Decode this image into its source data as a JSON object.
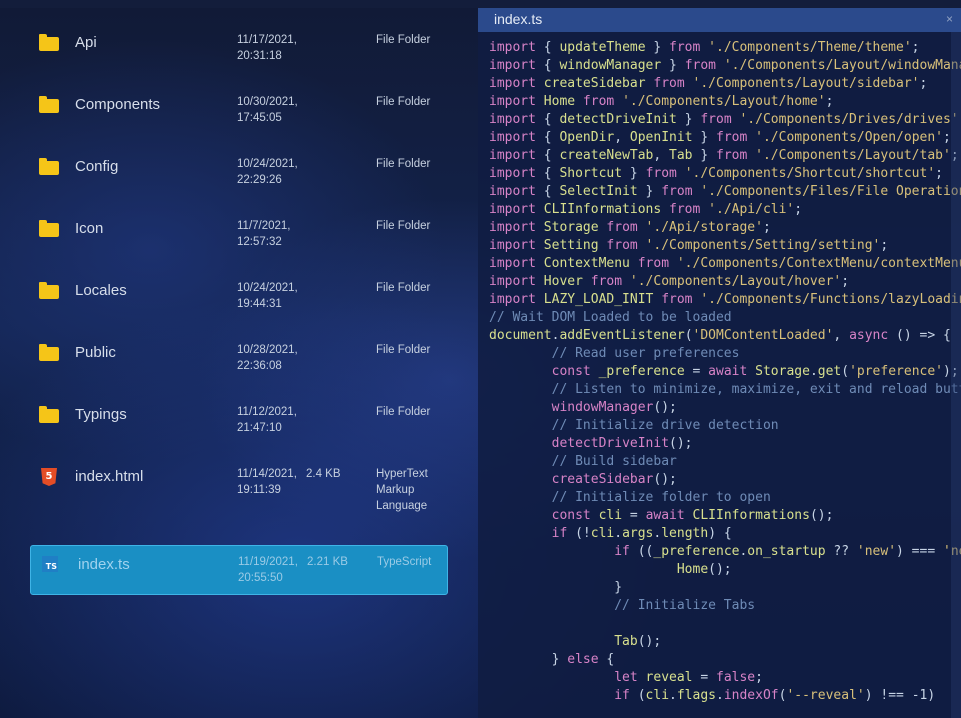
{
  "files": [
    {
      "name": "Api",
      "date_line1": "11/17/2021,",
      "date_line2": "20:31:18",
      "size": "",
      "type": "File Folder",
      "icon": "folder-icon"
    },
    {
      "name": "Components",
      "date_line1": "10/30/2021,",
      "date_line2": "17:45:05",
      "size": "",
      "type": "File Folder",
      "icon": "folder-icon"
    },
    {
      "name": "Config",
      "date_line1": "10/24/2021,",
      "date_line2": "22:29:26",
      "size": "",
      "type": "File Folder",
      "icon": "folder-icon"
    },
    {
      "name": "Icon",
      "date_line1": "11/7/2021,",
      "date_line2": "12:57:32",
      "size": "",
      "type": "File Folder",
      "icon": "folder-icon"
    },
    {
      "name": "Locales",
      "date_line1": "10/24/2021,",
      "date_line2": "19:44:31",
      "size": "",
      "type": "File Folder",
      "icon": "folder-icon"
    },
    {
      "name": "Public",
      "date_line1": "10/28/2021,",
      "date_line2": "22:36:08",
      "size": "",
      "type": "File Folder",
      "icon": "folder-icon"
    },
    {
      "name": "Typings",
      "date_line1": "11/12/2021,",
      "date_line2": "21:47:10",
      "size": "",
      "type": "File Folder",
      "icon": "folder-icon"
    },
    {
      "name": "index.html",
      "date_line1": "11/14/2021,",
      "date_line2": "19:11:39",
      "size": "2.4 KB",
      "type": "HyperText Markup Language",
      "icon": "html5-icon"
    },
    {
      "name": "index.ts",
      "date_line1": "11/19/2021,",
      "date_line2": "20:55:50",
      "size": "2.21 KB",
      "type": "TypeScript",
      "icon": "typescript-icon",
      "selected": true
    }
  ],
  "preview": {
    "title": "index.ts",
    "close": "×",
    "lines": [
      [
        [
          "kw",
          "import"
        ],
        [
          "pl",
          " { "
        ],
        [
          "id",
          "updateTheme"
        ],
        [
          "pl",
          " } "
        ],
        [
          "kw",
          "from"
        ],
        [
          "str",
          " './Components/Theme/theme'"
        ],
        [
          "pl",
          ";"
        ]
      ],
      [
        [
          "kw",
          "import"
        ],
        [
          "pl",
          " { "
        ],
        [
          "id",
          "windowManager"
        ],
        [
          "pl",
          " } "
        ],
        [
          "kw",
          "from"
        ],
        [
          "str",
          " './Components/Layout/windowManager'"
        ],
        [
          "pl",
          ";"
        ]
      ],
      [
        [
          "kw",
          "import"
        ],
        [
          "id",
          " createSidebar"
        ],
        [
          "kw",
          " from"
        ],
        [
          "str",
          " './Components/Layout/sidebar'"
        ],
        [
          "pl",
          ";"
        ]
      ],
      [
        [
          "kw",
          "import"
        ],
        [
          "id",
          " Home"
        ],
        [
          "kw",
          " from"
        ],
        [
          "str",
          " './Components/Layout/home'"
        ],
        [
          "pl",
          ";"
        ]
      ],
      [
        [
          "kw",
          "import"
        ],
        [
          "pl",
          " { "
        ],
        [
          "id",
          "detectDriveInit"
        ],
        [
          "pl",
          " } "
        ],
        [
          "kw",
          "from"
        ],
        [
          "str",
          " './Components/Drives/drives'"
        ],
        [
          "pl",
          ";"
        ]
      ],
      [
        [
          "kw",
          "import"
        ],
        [
          "pl",
          " { "
        ],
        [
          "id",
          "OpenDir"
        ],
        [
          "pl",
          ", "
        ],
        [
          "id",
          "OpenInit"
        ],
        [
          "pl",
          " } "
        ],
        [
          "kw",
          "from"
        ],
        [
          "str",
          " './Components/Open/open'"
        ],
        [
          "pl",
          ";"
        ]
      ],
      [
        [
          "kw",
          "import"
        ],
        [
          "pl",
          " { "
        ],
        [
          "id",
          "createNewTab"
        ],
        [
          "pl",
          ", "
        ],
        [
          "id",
          "Tab"
        ],
        [
          "pl",
          " } "
        ],
        [
          "kw",
          "from"
        ],
        [
          "str",
          " './Components/Layout/tab'"
        ],
        [
          "pl",
          ";"
        ]
      ],
      [
        [
          "kw",
          "import"
        ],
        [
          "pl",
          " { "
        ],
        [
          "id",
          "Shortcut"
        ],
        [
          "pl",
          " } "
        ],
        [
          "kw",
          "from"
        ],
        [
          "str",
          " './Components/Shortcut/shortcut'"
        ],
        [
          "pl",
          ";"
        ]
      ],
      [
        [
          "kw",
          "import"
        ],
        [
          "pl",
          " { "
        ],
        [
          "id",
          "SelectInit"
        ],
        [
          "pl",
          " } "
        ],
        [
          "kw",
          "from"
        ],
        [
          "str",
          " './Components/Files/File Operation/select'"
        ],
        [
          "pl",
          ";"
        ]
      ],
      [
        [
          "kw",
          "import"
        ],
        [
          "id",
          " CLIInformations"
        ],
        [
          "kw",
          " from"
        ],
        [
          "str",
          " './Api/cli'"
        ],
        [
          "pl",
          ";"
        ]
      ],
      [
        [
          "kw",
          "import"
        ],
        [
          "id",
          " Storage"
        ],
        [
          "kw",
          " from"
        ],
        [
          "str",
          " './Api/storage'"
        ],
        [
          "pl",
          ";"
        ]
      ],
      [
        [
          "kw",
          "import"
        ],
        [
          "id",
          " Setting"
        ],
        [
          "kw",
          " from"
        ],
        [
          "str",
          " './Components/Setting/setting'"
        ],
        [
          "pl",
          ";"
        ]
      ],
      [
        [
          "kw",
          "import"
        ],
        [
          "id",
          " ContextMenu"
        ],
        [
          "kw",
          " from"
        ],
        [
          "str",
          " './Components/ContextMenu/contextMenu'"
        ],
        [
          "pl",
          ";"
        ]
      ],
      [
        [
          "kw",
          "import"
        ],
        [
          "id",
          " Hover"
        ],
        [
          "kw",
          " from"
        ],
        [
          "str",
          " './Components/Layout/hover'"
        ],
        [
          "pl",
          ";"
        ]
      ],
      [
        [
          "kw",
          "import"
        ],
        [
          "id",
          " LAZY_LOAD_INIT"
        ],
        [
          "kw",
          " from"
        ],
        [
          "str",
          " './Components/Functions/lazyLoadingImage'"
        ],
        [
          "pl",
          ";"
        ]
      ],
      [
        [
          "cm",
          "// Wait DOM Loaded to be loaded"
        ]
      ],
      [
        [
          "id",
          "document"
        ],
        [
          "pl",
          "."
        ],
        [
          "id",
          "addEventListener"
        ],
        [
          "pl",
          "("
        ],
        [
          "str",
          "'DOMContentLoaded'"
        ],
        [
          "pl",
          ", "
        ],
        [
          "kw",
          "async"
        ],
        [
          "pl",
          " () => {"
        ]
      ],
      [
        [
          "pl",
          "        "
        ],
        [
          "cm",
          "// Read user preferences"
        ]
      ],
      [
        [
          "pl",
          "        "
        ],
        [
          "kw",
          "const"
        ],
        [
          "id",
          " _preference"
        ],
        [
          "pl",
          " = "
        ],
        [
          "kw",
          "await"
        ],
        [
          "id",
          " Storage"
        ],
        [
          "pl",
          "."
        ],
        [
          "id",
          "get"
        ],
        [
          "pl",
          "("
        ],
        [
          "str",
          "'preference'"
        ],
        [
          "pl",
          ");"
        ]
      ],
      [
        [
          "pl",
          "        "
        ],
        [
          "cm",
          "// Listen to minimize, maximize, exit and reload button"
        ]
      ],
      [
        [
          "pl",
          "        "
        ],
        [
          "kw",
          "windowManager"
        ],
        [
          "pl",
          "();"
        ]
      ],
      [
        [
          "pl",
          "        "
        ],
        [
          "cm",
          "// Initialize drive detection"
        ]
      ],
      [
        [
          "pl",
          "        "
        ],
        [
          "kw",
          "detectDriveInit"
        ],
        [
          "pl",
          "();"
        ]
      ],
      [
        [
          "pl",
          "        "
        ],
        [
          "cm",
          "// Build sidebar"
        ]
      ],
      [
        [
          "pl",
          "        "
        ],
        [
          "kw",
          "createSidebar"
        ],
        [
          "pl",
          "();"
        ]
      ],
      [
        [
          "pl",
          "        "
        ],
        [
          "cm",
          "// Initialize folder to open"
        ]
      ],
      [
        [
          "pl",
          "        "
        ],
        [
          "kw",
          "const"
        ],
        [
          "id",
          " cli"
        ],
        [
          "pl",
          " = "
        ],
        [
          "kw",
          "await"
        ],
        [
          "id",
          " CLIInformations"
        ],
        [
          "pl",
          "();"
        ]
      ],
      [
        [
          "pl",
          "        "
        ],
        [
          "kw",
          "if"
        ],
        [
          "pl",
          " (!"
        ],
        [
          "id",
          "cli"
        ],
        [
          "pl",
          "."
        ],
        [
          "id",
          "args"
        ],
        [
          "pl",
          "."
        ],
        [
          "id",
          "length"
        ],
        [
          "pl",
          ") {"
        ]
      ],
      [
        [
          "pl",
          "                "
        ],
        [
          "kw",
          "if"
        ],
        [
          "pl",
          " (("
        ],
        [
          "id",
          "_preference"
        ],
        [
          "pl",
          "."
        ],
        [
          "id",
          "on_startup"
        ],
        [
          "pl",
          " ?? "
        ],
        [
          "str",
          "'new'"
        ],
        [
          "pl",
          ") === "
        ],
        [
          "str",
          "'new'"
        ],
        [
          "pl",
          ") {"
        ]
      ],
      [
        [
          "pl",
          "                        "
        ],
        [
          "id",
          "Home"
        ],
        [
          "pl",
          "();"
        ]
      ],
      [
        [
          "pl",
          "                }"
        ]
      ],
      [
        [
          "pl",
          "                "
        ],
        [
          "cm",
          "// Initialize Tabs"
        ]
      ],
      [
        [
          "pl",
          ""
        ]
      ],
      [
        [
          "pl",
          "                "
        ],
        [
          "id",
          "Tab"
        ],
        [
          "pl",
          "();"
        ]
      ],
      [
        [
          "pl",
          "        } "
        ],
        [
          "kw",
          "else"
        ],
        [
          "pl",
          " {"
        ]
      ],
      [
        [
          "pl",
          "                "
        ],
        [
          "kw",
          "let"
        ],
        [
          "id",
          " reveal"
        ],
        [
          "pl",
          " = "
        ],
        [
          "kw",
          "false"
        ],
        [
          "pl",
          ";"
        ]
      ],
      [
        [
          "pl",
          "                "
        ],
        [
          "kw",
          "if"
        ],
        [
          "pl",
          " ("
        ],
        [
          "id",
          "cli"
        ],
        [
          "pl",
          "."
        ],
        [
          "id",
          "flags"
        ],
        [
          "pl",
          "."
        ],
        [
          "kw",
          "indexOf"
        ],
        [
          "pl",
          "("
        ],
        [
          "str",
          "'--reveal'"
        ],
        [
          "pl",
          ") !== -1)"
        ]
      ]
    ]
  }
}
